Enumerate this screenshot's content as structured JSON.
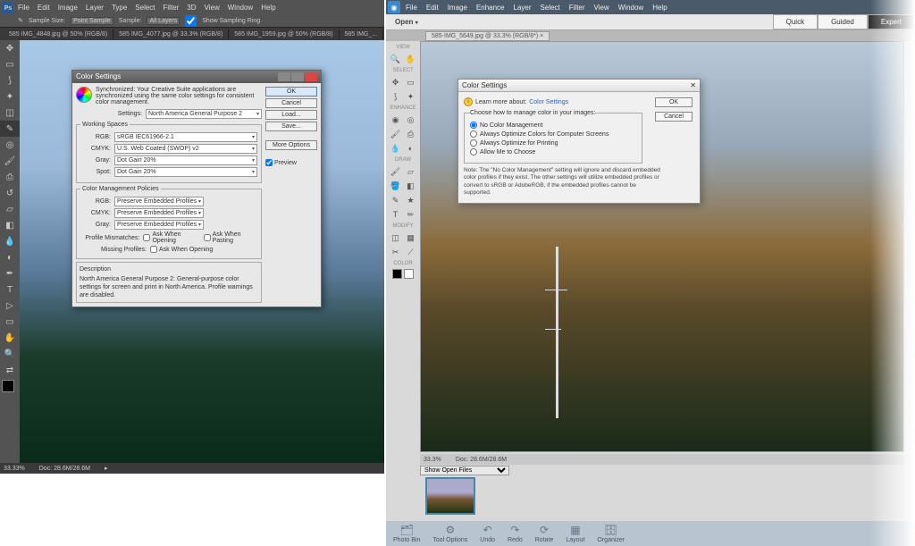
{
  "ps": {
    "menu": [
      "File",
      "Edit",
      "Image",
      "Layer",
      "Type",
      "Select",
      "Filter",
      "3D",
      "View",
      "Window",
      "Help"
    ],
    "opt": {
      "size_label": "Sample Size:",
      "size_val": "Point Sample",
      "sample_label": "Sample:",
      "sample_val": "All Layers",
      "showring": "Show Sampling Ring"
    },
    "tabs": [
      "585 IMG_4848.jpg @ 50% (RGB/8)",
      "585 IMG_4077.jpg @ 33.3% (RGB/8)",
      "585 IMG_1959.jpg @ 50% (RGB/8)",
      "585 IMG_..."
    ],
    "status": {
      "zoom": "33.33%",
      "doc": "Doc: 28.6M/28.6M"
    },
    "dlg": {
      "title": "Color Settings",
      "sync": "Synchronized: Your Creative Suite applications are synchronized using the same color settings for consistent color management.",
      "settings_label": "Settings:",
      "settings_val": "North America General Purpose 2",
      "ws_legend": "Working Spaces",
      "ws": {
        "rgb": "sRGB IEC61966-2.1",
        "cmyk": "U.S. Web Coated (SWOP) v2",
        "gray": "Dot Gain 20%",
        "spot": "Dot Gain 20%"
      },
      "pol_legend": "Color Management Policies",
      "pol": {
        "rgb": "Preserve Embedded Profiles",
        "cmyk": "Preserve Embedded Profiles",
        "gray": "Preserve Embedded Profiles"
      },
      "mismatch_label": "Profile Mismatches:",
      "ask_open": "Ask When Opening",
      "ask_paste": "Ask When Pasting",
      "missing_label": "Missing Profiles:",
      "desc_legend": "Description",
      "desc": "North America General Purpose 2: General-purpose color settings for screen and print in North America. Profile warnings are disabled.",
      "btns": {
        "ok": "OK",
        "cancel": "Cancel",
        "load": "Load...",
        "save": "Save...",
        "more": "More Options",
        "preview": "Preview"
      },
      "labels": {
        "rgb": "RGB:",
        "cmyk": "CMYK:",
        "gray": "Gray:",
        "spot": "Spot:"
      }
    }
  },
  "pse": {
    "menu": [
      "File",
      "Edit",
      "Image",
      "Enhance",
      "Layer",
      "Select",
      "Filter",
      "View",
      "Window",
      "Help"
    ],
    "open": "Open",
    "modes": [
      "Quick",
      "Guided",
      "Expert"
    ],
    "tab": "585-IMG_5649.jpg @ 33.3% (RGB/8*)",
    "sections": {
      "view": "VIEW",
      "select": "SELECT",
      "enhance": "ENHANCE",
      "draw": "DRAW",
      "modify": "MODIFY",
      "color": "COLOR"
    },
    "stat": {
      "zoom": "33.3%",
      "doc": "Doc: 28.6M/28.6M"
    },
    "openfiles": "Show Open Files",
    "bottom": [
      "Photo Bin",
      "Tool Options",
      "Undo",
      "Redo",
      "Rotate",
      "Layout",
      "Organizer"
    ],
    "dlg": {
      "title": "Color Settings",
      "learn_label": "Learn more about:",
      "learn_link": "Color Settings",
      "legend": "Choose how to manage color in your images:",
      "opts": [
        "No Color Management",
        "Always Optimize Colors for Computer Screens",
        "Always Optimize for Printing",
        "Allow Me to Choose"
      ],
      "note": "Note: The \"No Color Management\" setting will ignore and discard embedded color profiles if they exist. The other settings will utilize embedded profiles or convert to sRGB or AdobeRGB, if the embedded profiles cannot be supported.",
      "ok": "OK",
      "cancel": "Cancel"
    }
  }
}
